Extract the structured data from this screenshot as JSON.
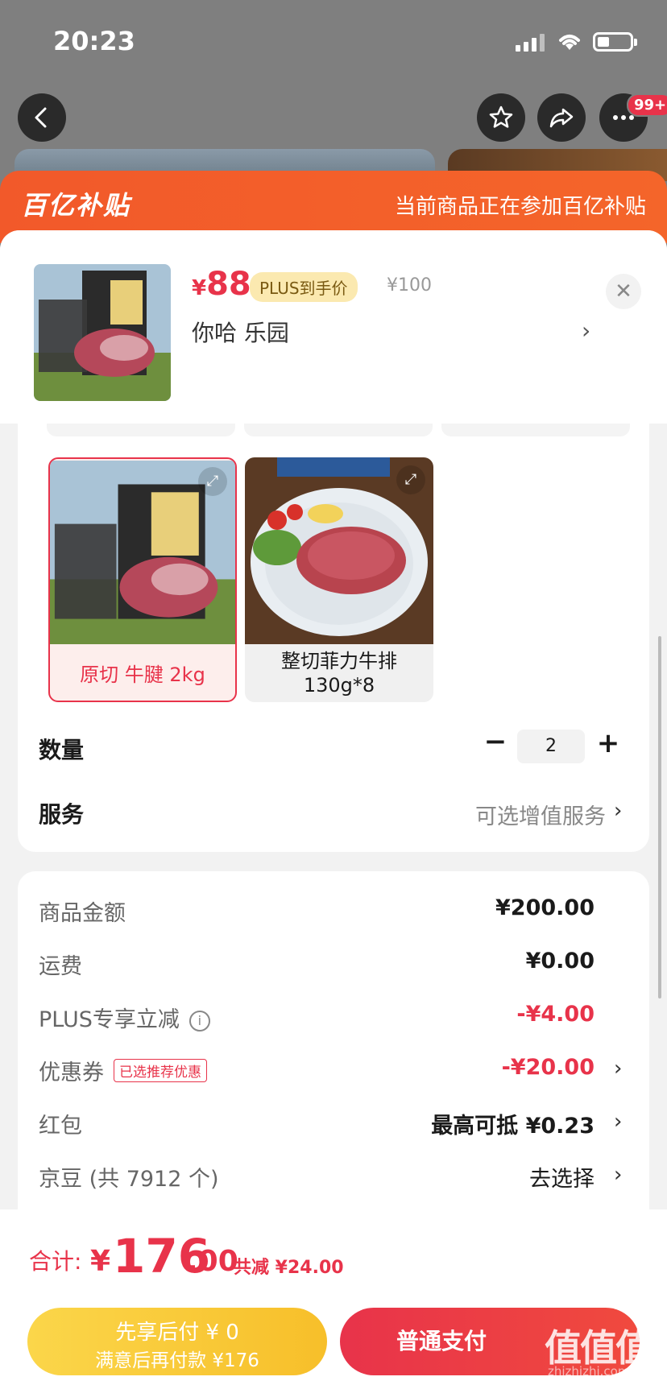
{
  "status_bar": {
    "time": "20:23"
  },
  "header": {
    "badge": "99+"
  },
  "banner": {
    "logo_text": "百亿补贴",
    "note": "当前商品正在参加百亿补贴"
  },
  "product": {
    "price_symbol": "¥",
    "price": "88",
    "plus_tag": "PLUS到手价",
    "original_price": "¥100",
    "selected_spec": "你哈  乐园",
    "close_label": "✕"
  },
  "options": [
    {
      "label": "原切 牛腱 2kg",
      "selected": true
    },
    {
      "label": "整切菲力牛排 130g*8",
      "selected": false
    }
  ],
  "quantity": {
    "label": "数量",
    "minus": "−",
    "value": "2",
    "plus": "+"
  },
  "service": {
    "label": "服务",
    "value": "可选增值服务"
  },
  "summary": {
    "goods_amount_label": "商品金额",
    "goods_amount": "¥200.00",
    "shipping_label": "运费",
    "shipping": "¥0.00",
    "plus_discount_label": "PLUS专享立减",
    "plus_discount": "-¥4.00",
    "coupon_label": "优惠券",
    "coupon_tag": "已选推荐优惠",
    "coupon": "-¥20.00",
    "redpacket_label": "红包",
    "redpacket": "最高可抵 ¥0.23",
    "jingdou_label": "京豆 (共 7912 个)",
    "jingdou": "去选择"
  },
  "footer": {
    "total_label": "合计:",
    "total_yen": "¥",
    "total_int": "176",
    "total_dec": ".00",
    "total_saved": "共减 ¥24.00",
    "later_pay_title": "先享后付 ¥ 0",
    "later_pay_sub": "满意后再付款 ¥176",
    "pay_label": "普通支付",
    "watermark": "值值值",
    "watermark_sub": "zhizhizhi.com"
  },
  "colors": {
    "accent": "#e8334a",
    "banner": "#f2592a",
    "plus_tag_bg": "#fbe9b0"
  }
}
